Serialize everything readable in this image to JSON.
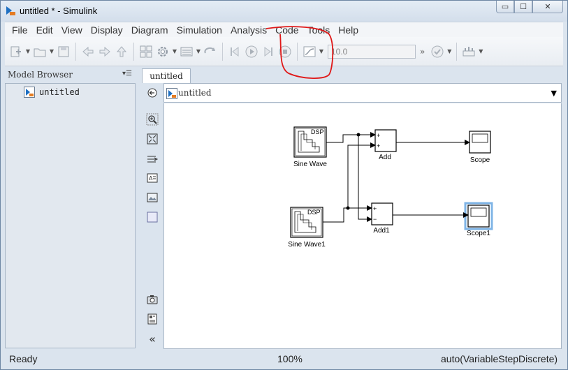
{
  "window": {
    "title": "untitled * - Simulink",
    "minimize_glyph": "▭",
    "maximize_glyph": "☐",
    "close_glyph": "✕"
  },
  "menu": [
    "File",
    "Edit",
    "View",
    "Display",
    "Diagram",
    "Simulation",
    "Analysis",
    "Code",
    "Tools",
    "Help"
  ],
  "toolbar": {
    "stop_time": "10.0",
    "more": "»"
  },
  "model_browser": {
    "title": "Model Browser",
    "menu_glyph": "▾☰",
    "items": [
      {
        "label": "untitled"
      }
    ]
  },
  "tab": {
    "label": "untitled"
  },
  "address": {
    "path": "untitled"
  },
  "blocks": {
    "sine1": {
      "label": "Sine Wave",
      "badge": "DSP"
    },
    "sine2": {
      "label": "Sine Wave1",
      "badge": "DSP"
    },
    "add1": {
      "label": "Add",
      "port1": "+",
      "port2": "+"
    },
    "add2": {
      "label": "Add1",
      "port1": "+",
      "port2": "−"
    },
    "scope1": {
      "label": "Scope"
    },
    "scope2": {
      "label": "Scope1"
    }
  },
  "status": {
    "ready": "Ready",
    "zoom": "100%",
    "solver": "auto(VariableStepDiscrete)"
  },
  "colors": {
    "annotation": "#e01818",
    "selection": "#7fb4e6",
    "block_stroke": "#000000"
  }
}
